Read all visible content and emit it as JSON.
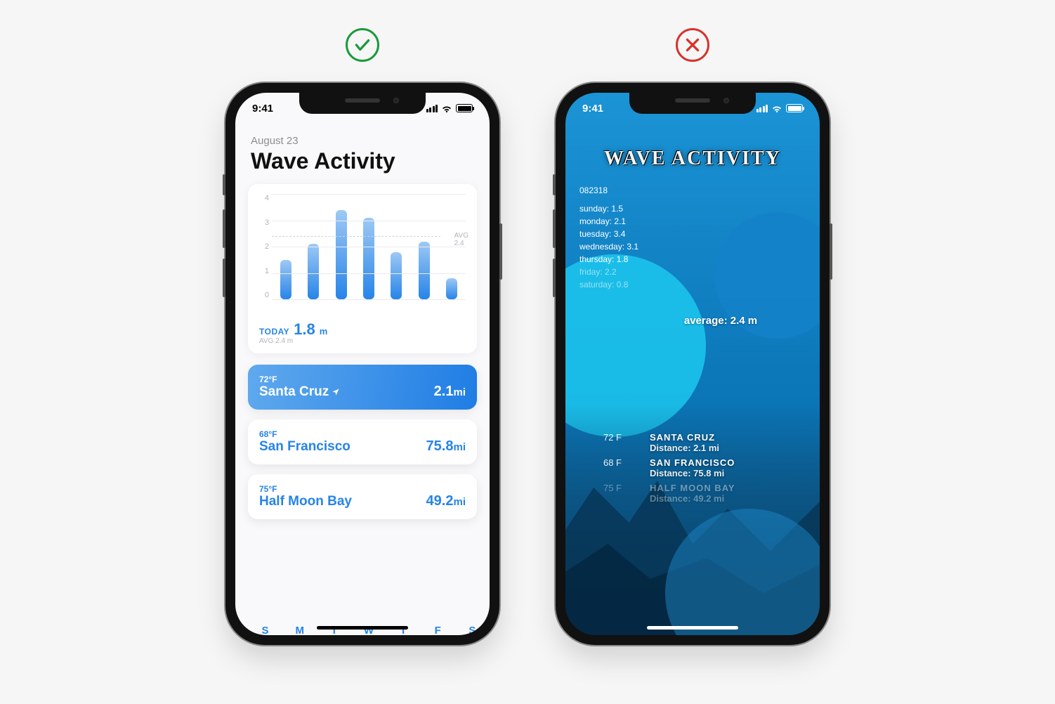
{
  "status_time": "9:41",
  "good": {
    "date": "August 23",
    "title": "Wave Activity",
    "avg_tag_label": "AVG",
    "avg_tag_value": "2.4",
    "today_label": "TODAY",
    "today_value": "1.8",
    "today_unit": "m",
    "footer_avg": "AVG 2.4 m",
    "locations": [
      {
        "temp": "72°F",
        "name": "Santa Cruz",
        "distance": "2.1",
        "unit": "mi",
        "active": true
      },
      {
        "temp": "68°F",
        "name": "San Francisco",
        "distance": "75.8",
        "unit": "mi",
        "active": false
      },
      {
        "temp": "75°F",
        "name": "Half Moon Bay",
        "distance": "49.2",
        "unit": "mi",
        "active": false
      }
    ]
  },
  "bad": {
    "title": "WAVE ACTIVITY",
    "datecode": "082318",
    "day_lines": [
      "sunday: 1.5",
      "monday: 2.1",
      "tuesday: 3.4",
      "wednesday: 3.1",
      "thursday: 1.8",
      "friday: 2.2",
      "saturday: 0.8"
    ],
    "average_line": "average: 2.4 m",
    "locations": [
      {
        "temp": "72 F",
        "name": "SANTA CRUZ",
        "dist": "Distance: 2.1 mi"
      },
      {
        "temp": "68 F",
        "name": "SAN FRANCISCO",
        "dist": "Distance: 75.8 mi"
      },
      {
        "temp": "75 F",
        "name": "HALF MOON BAY",
        "dist": "Distance: 49.2 mi"
      }
    ]
  },
  "chart_data": {
    "type": "bar",
    "categories": [
      "S",
      "M",
      "T",
      "W",
      "T",
      "F",
      "S"
    ],
    "values": [
      1.5,
      2.1,
      3.4,
      3.1,
      1.8,
      2.2,
      0.8
    ],
    "ylabel": "",
    "ylim": [
      0,
      4
    ],
    "yticks": [
      0,
      1,
      2,
      3,
      4
    ],
    "avg": 2.4,
    "avg_label": "AVG"
  }
}
